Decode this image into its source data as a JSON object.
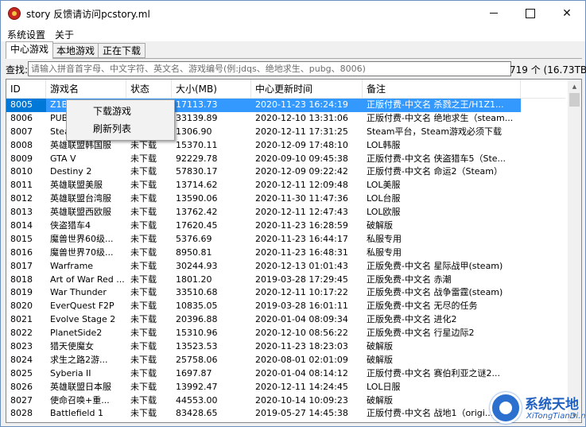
{
  "window": {
    "title": "story 反馈请访问pcstory.ml",
    "minimize_label": "",
    "maximize_label": "",
    "close_label": "✕"
  },
  "menu": [
    "系统设置",
    "关于"
  ],
  "tabs": [
    "中心游戏",
    "本地游戏",
    "正在下载"
  ],
  "search": {
    "label": "查找:",
    "placeholder": "请输入拼音首字母、中文字符、英文名、游戏编号(例:jdqs、绝地求生、pubg、8006)",
    "count": "719 个 (16.73TB)"
  },
  "table": {
    "columns": [
      "ID",
      "游戏名",
      "状态",
      "大小(MB)",
      "中心更新时间",
      "备注"
    ],
    "rows": [
      [
        "8005",
        "Z1B",
        "",
        "17113.73",
        "2020-11-23 16:24:19",
        "正版付费-中文名 杀戮之王/H1Z1..."
      ],
      [
        "8006",
        "PUB",
        "",
        "33139.89",
        "2020-12-10 13:31:06",
        "正版付费-中文名 绝地求生（steam..."
      ],
      [
        "8007",
        "Stea",
        "",
        "1306.90",
        "2020-12-11 17:31:25",
        "Steam平台，Steam游戏必须下载"
      ],
      [
        "8008",
        "英雄联盟韩国服",
        "未下载",
        "15370.11",
        "2020-12-09 17:48:10",
        "LOL韩服"
      ],
      [
        "8009",
        "GTA V",
        "未下载",
        "92229.78",
        "2020-09-10 09:45:38",
        "正版付费-中文名 侠盗猎车5（Ste..."
      ],
      [
        "8010",
        "Destiny 2",
        "未下载",
        "57830.17",
        "2020-12-09 09:22:42",
        "正版付费-中文名 命运2（Steam）"
      ],
      [
        "8011",
        "英雄联盟美服",
        "未下载",
        "13714.62",
        "2020-12-11 12:09:48",
        "LOL美服"
      ],
      [
        "8012",
        "英雄联盟台湾服",
        "未下载",
        "13590.06",
        "2020-11-30 11:47:36",
        "LOL台服"
      ],
      [
        "8013",
        "英雄联盟西欧服",
        "未下载",
        "13762.42",
        "2020-12-11 12:47:43",
        "LOL欧服"
      ],
      [
        "8014",
        "侠盗猎车4",
        "未下载",
        "17620.45",
        "2020-11-23 16:28:59",
        "破解版"
      ],
      [
        "8015",
        "魔兽世界60级...",
        "未下载",
        "5376.69",
        "2020-11-23 16:44:17",
        "私服专用"
      ],
      [
        "8016",
        "魔兽世界70级...",
        "未下载",
        "8950.81",
        "2020-11-23 16:48:31",
        "私服专用"
      ],
      [
        "8017",
        "Warframe",
        "未下载",
        "30244.93",
        "2020-12-13 01:01:43",
        "正版免费-中文名 星际战甲(steam)"
      ],
      [
        "8018",
        "Art of War Red ...",
        "未下载",
        "1801.20",
        "2019-03-28 17:29:45",
        "正版免费-中文名 赤潮"
      ],
      [
        "8019",
        "War Thunder",
        "未下载",
        "33510.68",
        "2020-12-11 10:17:22",
        "正版免费-中文名 战争雷霆(steam)"
      ],
      [
        "8020",
        "EverQuest F2P",
        "未下载",
        "10835.05",
        "2019-03-28 16:01:11",
        "正版免费-中文名 无尽的任务"
      ],
      [
        "8021",
        "Evolve Stage 2",
        "未下载",
        "20396.88",
        "2020-01-04 08:09:34",
        "正版免费-中文名 进化2"
      ],
      [
        "8022",
        "PlanetSide2",
        "未下载",
        "15310.96",
        "2020-12-10 08:56:22",
        "正版免费-中文名 行星边际2"
      ],
      [
        "8023",
        "猎天使魔女",
        "未下载",
        "13523.53",
        "2020-11-23 18:23:03",
        "破解版"
      ],
      [
        "8024",
        "求生之路2游...",
        "未下载",
        "25758.06",
        "2020-08-01 02:01:09",
        "破解版"
      ],
      [
        "8025",
        "Syberia II",
        "未下载",
        "1697.87",
        "2020-01-04 08:14:12",
        "正版付费-中文名 赛伯利亚之谜2..."
      ],
      [
        "8026",
        "英雄联盟日本服",
        "未下载",
        "13992.47",
        "2020-12-11 14:24:45",
        "LOL日服"
      ],
      [
        "8027",
        "使命召唤+重...",
        "未下载",
        "44553.00",
        "2020-10-14 10:09:23",
        "破解版"
      ],
      [
        "8028",
        "Battlefield 1",
        "未下载",
        "83428.65",
        "2019-05-27 14:45:38",
        "正版付费-中文名 战地1（origi..."
      ]
    ]
  },
  "context_menu": [
    "下载游戏",
    "刷新列表"
  ],
  "watermark": {
    "title": "系统天地",
    "subtitle": "XiTongTianDi.net"
  },
  "colors": {
    "selection": "#3399ff",
    "window_border": "#6b8fbf",
    "watermark": "#1f5fbf"
  }
}
